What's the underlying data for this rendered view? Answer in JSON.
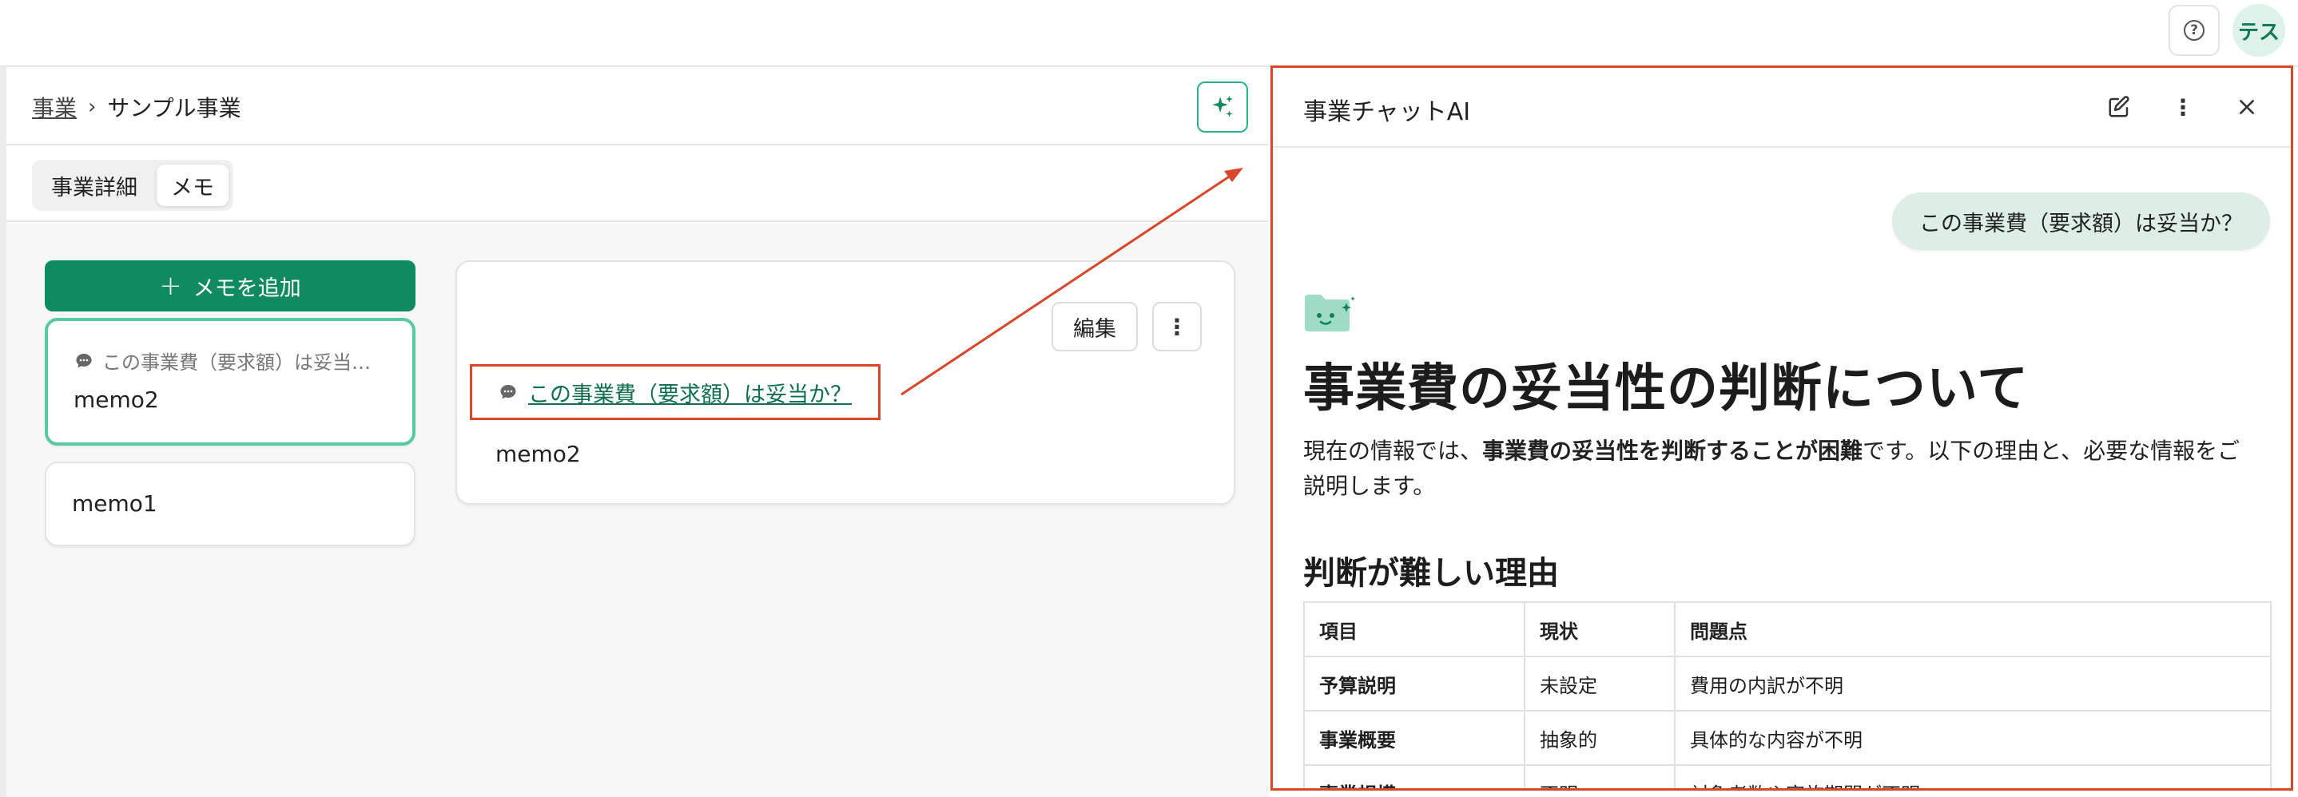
{
  "topbar": {
    "help_icon": "question-circle-icon",
    "avatar_text": "テス"
  },
  "breadcrumb": {
    "parent": "事業",
    "current": "サンプル事業"
  },
  "tabs": [
    {
      "label": "事業詳細",
      "active": false
    },
    {
      "label": "メモ",
      "active": true
    }
  ],
  "memo_list": {
    "add_label": "メモを追加",
    "items": [
      {
        "ref": "この事業費（要求額）は妥当…",
        "title": "memo2",
        "selected": true
      },
      {
        "title": "memo1",
        "selected": false
      }
    ]
  },
  "memo_detail": {
    "edit_label": "編集",
    "ref_link": "この事業費（要求額）は妥当か？",
    "body": "memo2"
  },
  "chat": {
    "title": "事業チャットAI",
    "user_message": "この事業費（要求額）は妥当か？",
    "answer_title": "事業費の妥当性の判断について",
    "answer_para_pre": "現在の情報では、",
    "answer_para_bold": "事業費の妥当性を判断することが困難",
    "answer_para_post": "です。以下の理由と、必要な情報をご説明します。",
    "section_title": "判断が難しい理由",
    "table": {
      "headers": [
        "項目",
        "現状",
        "問題点"
      ],
      "rows": [
        [
          "予算説明",
          "未設定",
          "費用の内訳が不明"
        ],
        [
          "事業概要",
          "抽象的",
          "具体的な内容が不明"
        ],
        [
          "事業規模",
          "不明",
          "対象者数や実施期間が不明"
        ]
      ]
    }
  },
  "colors": {
    "accent": "#108a61",
    "highlight": "#d9472a"
  }
}
